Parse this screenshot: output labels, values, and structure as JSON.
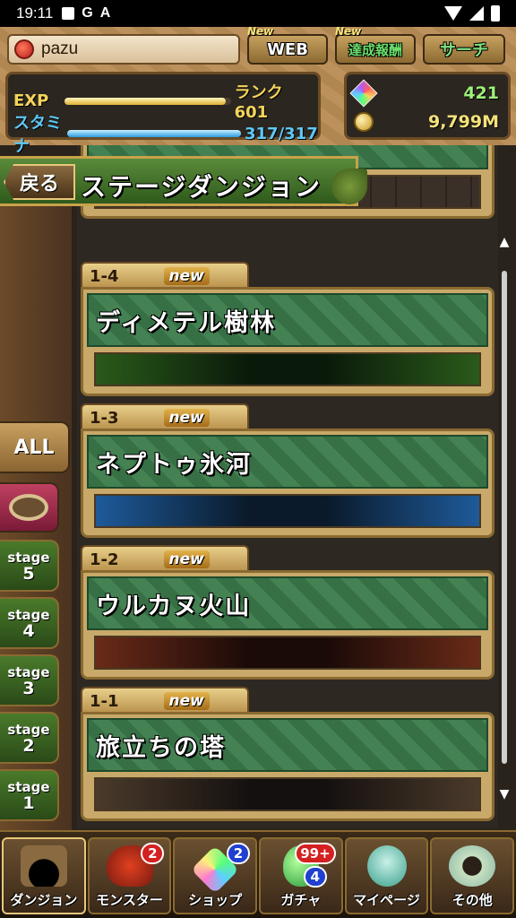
{
  "status_bar": {
    "time": "19:11",
    "notification_letters": [
      "G",
      "A"
    ]
  },
  "player": {
    "name": "pazu"
  },
  "hud_buttons": {
    "web": {
      "label": "WEB",
      "tag": "New"
    },
    "achievements": {
      "label": "達成報酬",
      "tag": "New"
    },
    "search": {
      "label": "サーチ"
    }
  },
  "stats": {
    "exp_label": "EXP",
    "rank_text": "ランク 601",
    "exp_progress": 0.97,
    "stamina_label": "スタミナ",
    "stamina_text": "317/317",
    "stamina_progress": 1.0,
    "magic_stones": "421",
    "coins": "9,799M"
  },
  "header": {
    "back_label": "戻る",
    "title": "ステージダンジョン"
  },
  "filters": {
    "all_label": "ALL",
    "stage_word": "stage",
    "stages": [
      "5",
      "4",
      "3",
      "2",
      "1"
    ]
  },
  "dungeons": [
    {
      "id": "1-4",
      "badge": "new",
      "name": "ディメテル樹林",
      "scene": "forest"
    },
    {
      "id": "1-3",
      "badge": "new",
      "name": "ネプトゥ氷河",
      "scene": "ice"
    },
    {
      "id": "1-2",
      "badge": "new",
      "name": "ウルカヌ火山",
      "scene": "fire"
    },
    {
      "id": "1-1",
      "badge": "new",
      "name": "旅立ちの塔",
      "scene": "tower"
    }
  ],
  "bottom_nav": [
    {
      "label": "ダンジョン",
      "icon": "dungeon-gate-icon",
      "badges": []
    },
    {
      "label": "モンスター",
      "icon": "monster-dragon-icon",
      "badges": [
        "2"
      ]
    },
    {
      "label": "ショップ",
      "icon": "magic-stone-icon",
      "badges": [
        "2"
      ]
    },
    {
      "label": "ガチャ",
      "icon": "egg-icon",
      "badges": [
        "99+",
        "4"
      ]
    },
    {
      "label": "マイページ",
      "icon": "mypage-character-icon",
      "badges": []
    },
    {
      "label": "その他",
      "icon": "other-icon",
      "badges": []
    }
  ],
  "colors": {
    "card_green": "#3a7a4a",
    "gold_border": "#c8a96a",
    "badge_red": "#d42020",
    "badge_blue": "#2040d0"
  }
}
